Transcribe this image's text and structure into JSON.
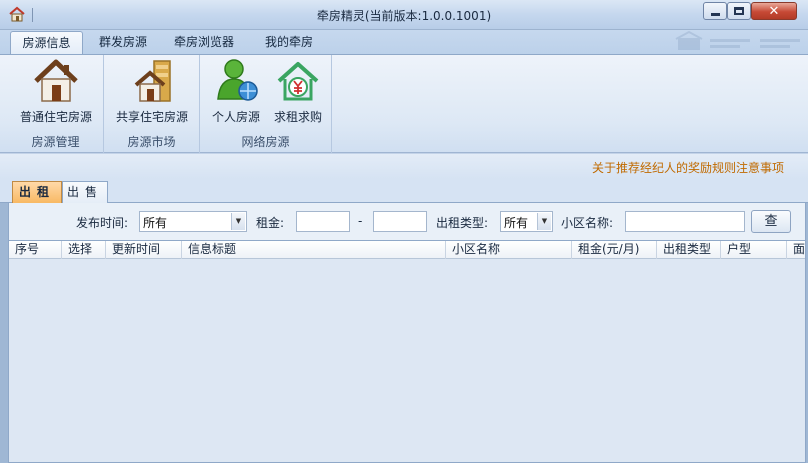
{
  "window": {
    "title": "牵房精灵(当前版本:1.0.0.1001)",
    "close_glyph": "✕"
  },
  "ribbon": {
    "tabs": [
      {
        "label": "房源信息"
      },
      {
        "label": "群发房源"
      },
      {
        "label": "牵房浏览器"
      },
      {
        "label": "我的牵房"
      }
    ],
    "groups": [
      {
        "label": "房源管理",
        "buttons": [
          {
            "label": "普通住宅房源",
            "icon": "house-icon"
          }
        ]
      },
      {
        "label": "房源市场",
        "buttons": [
          {
            "label": "共享住宅房源",
            "icon": "shared-house-icon"
          }
        ]
      },
      {
        "label": "网络房源",
        "buttons": [
          {
            "label": "个人房源",
            "icon": "person-globe-icon"
          },
          {
            "label": "求租求购",
            "icon": "yen-house-icon"
          }
        ]
      }
    ]
  },
  "notice": {
    "text": "关于推荐经纪人的奖励规则注意事项"
  },
  "listing_tabs": [
    {
      "label": "出租",
      "active": true
    },
    {
      "label": "出售",
      "active": false
    }
  ],
  "filters": {
    "publish_time_label": "发布时间:",
    "publish_time_value": "所有",
    "rent_label": "租金:",
    "rent_min": "",
    "rent_max": "",
    "rent_separator": "-",
    "rent_type_label": "出租类型:",
    "rent_type_value": "所有",
    "community_label": "小区名称:",
    "community_value": "",
    "search_button": "查"
  },
  "table": {
    "columns": [
      "序号",
      "选择",
      "更新时间",
      "信息标题",
      "小区名称",
      "租金(元/月)",
      "出租类型",
      "户型",
      "面"
    ],
    "rows": []
  },
  "colors": {
    "accent_tab": "#f8b964",
    "notice_link": "#c06a00",
    "close_button": "#c74a36"
  }
}
